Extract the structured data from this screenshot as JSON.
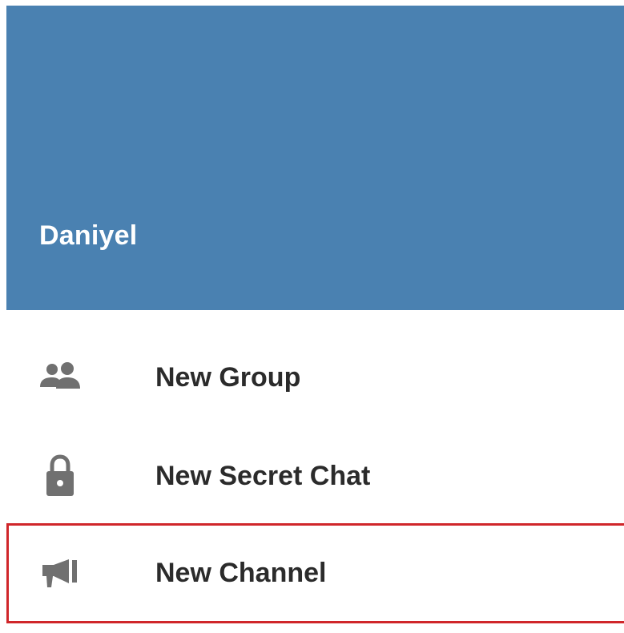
{
  "header": {
    "user_name": "Daniyel",
    "background_color": "#4a81b1"
  },
  "menu": {
    "items": [
      {
        "label": "New Group",
        "icon": "group-icon"
      },
      {
        "label": "New Secret Chat",
        "icon": "lock-icon"
      },
      {
        "label": "New Channel",
        "icon": "megaphone-icon",
        "highlighted": true
      }
    ],
    "highlight_color": "#d0262a"
  }
}
